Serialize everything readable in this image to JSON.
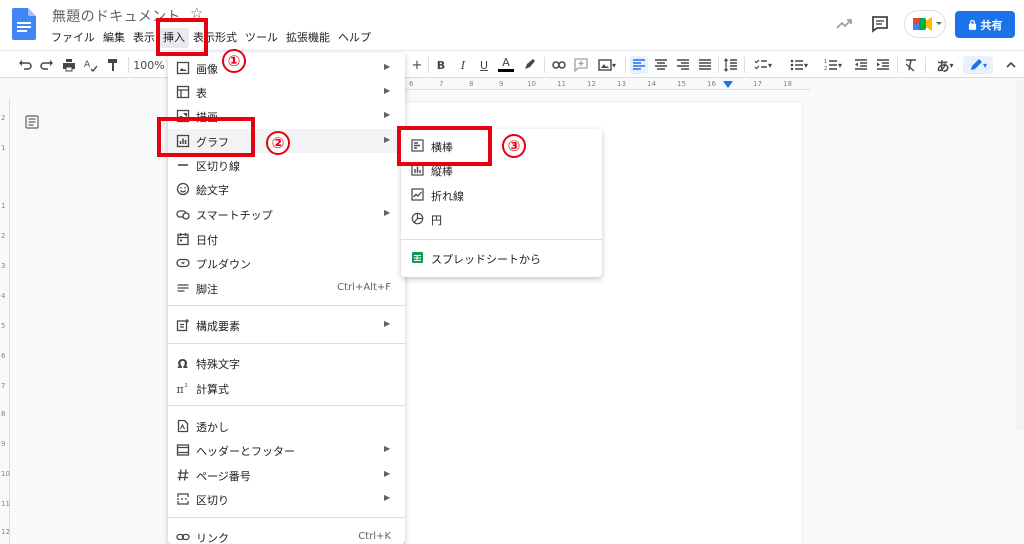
{
  "header": {
    "doc_title": "無題のドキュメント",
    "share_label": "共有"
  },
  "menubar": {
    "items": [
      "ファイル",
      "編集",
      "表示",
      "挿入",
      "表示形式",
      "ツール",
      "拡張機能",
      "ヘルプ"
    ]
  },
  "toolbar": {
    "zoom": "100%",
    "bold": "B",
    "italic": "I",
    "underline": "U",
    "text_color": "A",
    "input_tool": "あ"
  },
  "ruler": {
    "top_numbers": [
      "6",
      "7",
      "8",
      "9",
      "10",
      "11",
      "12",
      "13",
      "14",
      "15",
      "16",
      "17",
      "18"
    ],
    "left_numbers": [
      "2",
      "1",
      "1",
      "2",
      "3",
      "4",
      "5",
      "6",
      "7",
      "8",
      "9",
      "10",
      "11",
      "12"
    ]
  },
  "insert_menu": {
    "items": [
      {
        "label": "画像",
        "icon": "image-icon",
        "arrow": true
      },
      {
        "label": "表",
        "icon": "table-icon",
        "arrow": true
      },
      {
        "label": "描画",
        "icon": "drawing-icon",
        "arrow": true
      },
      {
        "label": "グラフ",
        "icon": "chart-icon",
        "arrow": true
      },
      {
        "label": "区切り線",
        "icon": "horizontal-line-icon"
      },
      {
        "label": "絵文字",
        "icon": "emoji-icon"
      },
      {
        "label": "スマートチップ",
        "icon": "smart-chip-icon",
        "arrow": true
      },
      {
        "label": "日付",
        "icon": "calendar-icon"
      },
      {
        "label": "プルダウン",
        "icon": "dropdown-icon"
      },
      {
        "label": "脚注",
        "icon": "footnote-icon",
        "shortcut": "Ctrl+Alt+F"
      },
      {
        "label": "構成要素",
        "icon": "building-blocks-icon",
        "arrow": true
      },
      {
        "label": "特殊文字",
        "icon": "omega-icon"
      },
      {
        "label": "計算式",
        "icon": "pi-icon"
      },
      {
        "label": "透かし",
        "icon": "watermark-icon"
      },
      {
        "label": "ヘッダーとフッター",
        "icon": "header-footer-icon",
        "arrow": true
      },
      {
        "label": "ページ番号",
        "icon": "hash-icon",
        "arrow": true
      },
      {
        "label": "区切り",
        "icon": "break-icon",
        "arrow": true
      },
      {
        "label": "リンク",
        "icon": "link-icon",
        "shortcut": "Ctrl+K"
      }
    ]
  },
  "chart_submenu": {
    "items": [
      {
        "label": "横棒",
        "icon": "bar-chart-icon"
      },
      {
        "label": "縦棒",
        "icon": "column-chart-icon"
      },
      {
        "label": "折れ線",
        "icon": "line-chart-icon"
      },
      {
        "label": "円",
        "icon": "pie-chart-icon"
      },
      {
        "label": "スプレッドシートから",
        "icon": "sheets-icon"
      }
    ]
  },
  "annotations": {
    "step1": "①",
    "step2": "②",
    "step3": "③",
    "color": "#e60012"
  },
  "colors": {
    "accent": "#1a73e8",
    "sheets_green": "#0f9d58"
  }
}
